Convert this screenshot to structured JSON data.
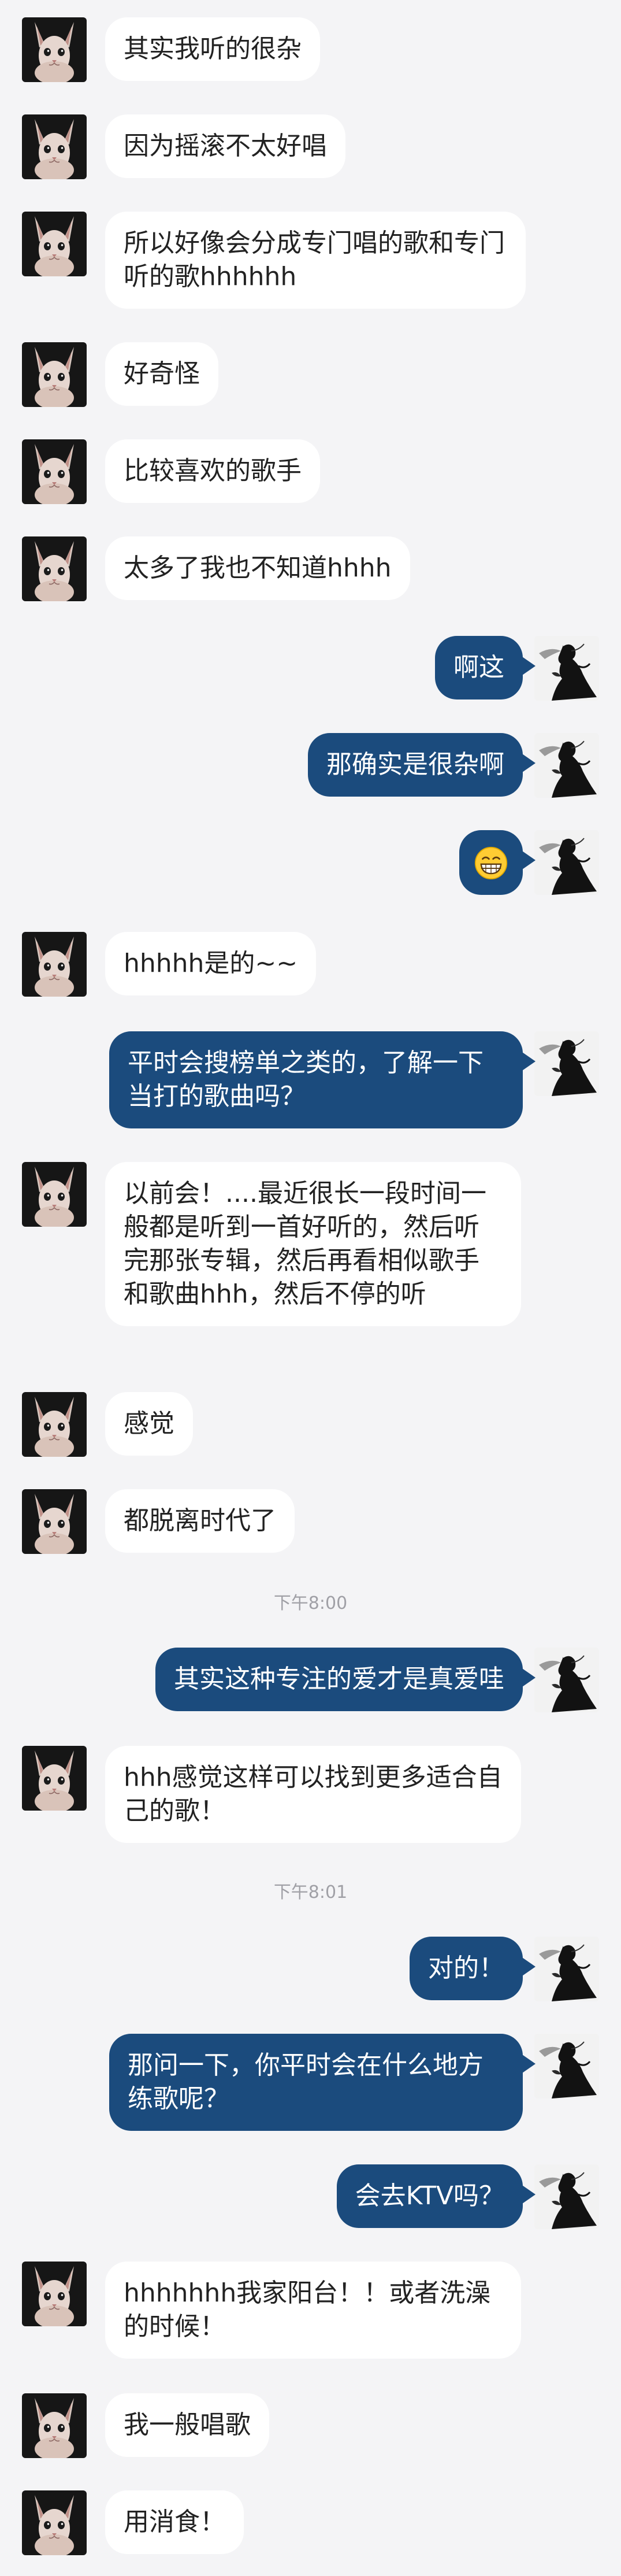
{
  "colors": {
    "background": "#f4f4f6",
    "incoming_bubble": "#ffffff",
    "outgoing_bubble": "#1b4b7d",
    "timestamp_text": "#a0a0a6"
  },
  "icons": {
    "incoming_avatar": "sphynx-cat-avatar",
    "outgoing_avatar": "black-ink-silhouette-avatar",
    "emoji": "grinning-face-emoji"
  },
  "messages": [
    {
      "side": "left",
      "text": "其实我听的很杂"
    },
    {
      "side": "left",
      "text": "因为摇滚不太好唱"
    },
    {
      "side": "left",
      "text": "所以好像会分成专门唱的歌和专门听的歌hhhhhh"
    },
    {
      "side": "left",
      "text": "好奇怪"
    },
    {
      "side": "left",
      "text": "比较喜欢的歌手"
    },
    {
      "side": "left",
      "text": "太多了我也不知道hhhh"
    },
    {
      "side": "right",
      "text": "啊这"
    },
    {
      "side": "right",
      "text": "那确实是很杂啊"
    },
    {
      "side": "right",
      "text": "",
      "emoji": "grinning-face-emoji"
    },
    {
      "side": "left",
      "text": "hhhhh是的~~"
    },
    {
      "side": "right",
      "text": "平时会搜榜单之类的，了解一下当打的歌曲吗？"
    },
    {
      "side": "left",
      "text": "以前会！....最近很长一段时间一般都是听到一首好听的，然后听完那张专辑，然后再看相似歌手和歌曲hhh，然后不停的听"
    },
    {
      "side": "left",
      "text": "感觉"
    },
    {
      "side": "left",
      "text": "都脱离时代了"
    },
    {
      "side": "time",
      "text": "下午8:00"
    },
    {
      "side": "right",
      "text": "其实这种专注的爱才是真爱哇"
    },
    {
      "side": "left",
      "text": "hhh感觉这样可以找到更多适合自己的歌！"
    },
    {
      "side": "time",
      "text": "下午8:01"
    },
    {
      "side": "right",
      "text": "对的！"
    },
    {
      "side": "right",
      "text": "那问一下，你平时会在什么地方练歌呢？"
    },
    {
      "side": "right",
      "text": "会去KTV吗？"
    },
    {
      "side": "left",
      "text": "hhhhhhh我家阳台！！或者洗澡的时候！"
    },
    {
      "side": "left",
      "text": "我一般唱歌"
    },
    {
      "side": "left",
      "text": "用消食！"
    }
  ]
}
